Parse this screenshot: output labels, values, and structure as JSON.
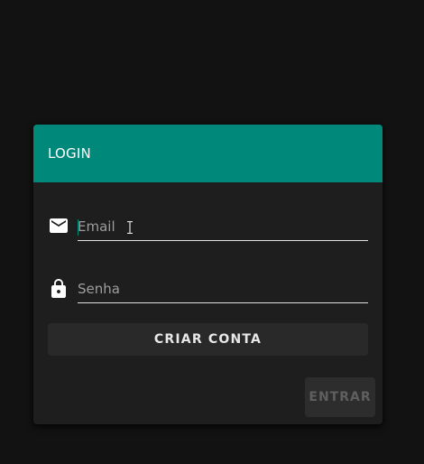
{
  "login_card": {
    "title": "LOGIN",
    "accent_color": "#00897b",
    "email_field": {
      "icon": "mail-icon",
      "placeholder": "Email",
      "value": ""
    },
    "password_field": {
      "icon": "lock-icon",
      "placeholder": "Senha",
      "value": ""
    },
    "create_account_label": "CRIAR CONTA",
    "enter_label": "ENTRAR"
  }
}
